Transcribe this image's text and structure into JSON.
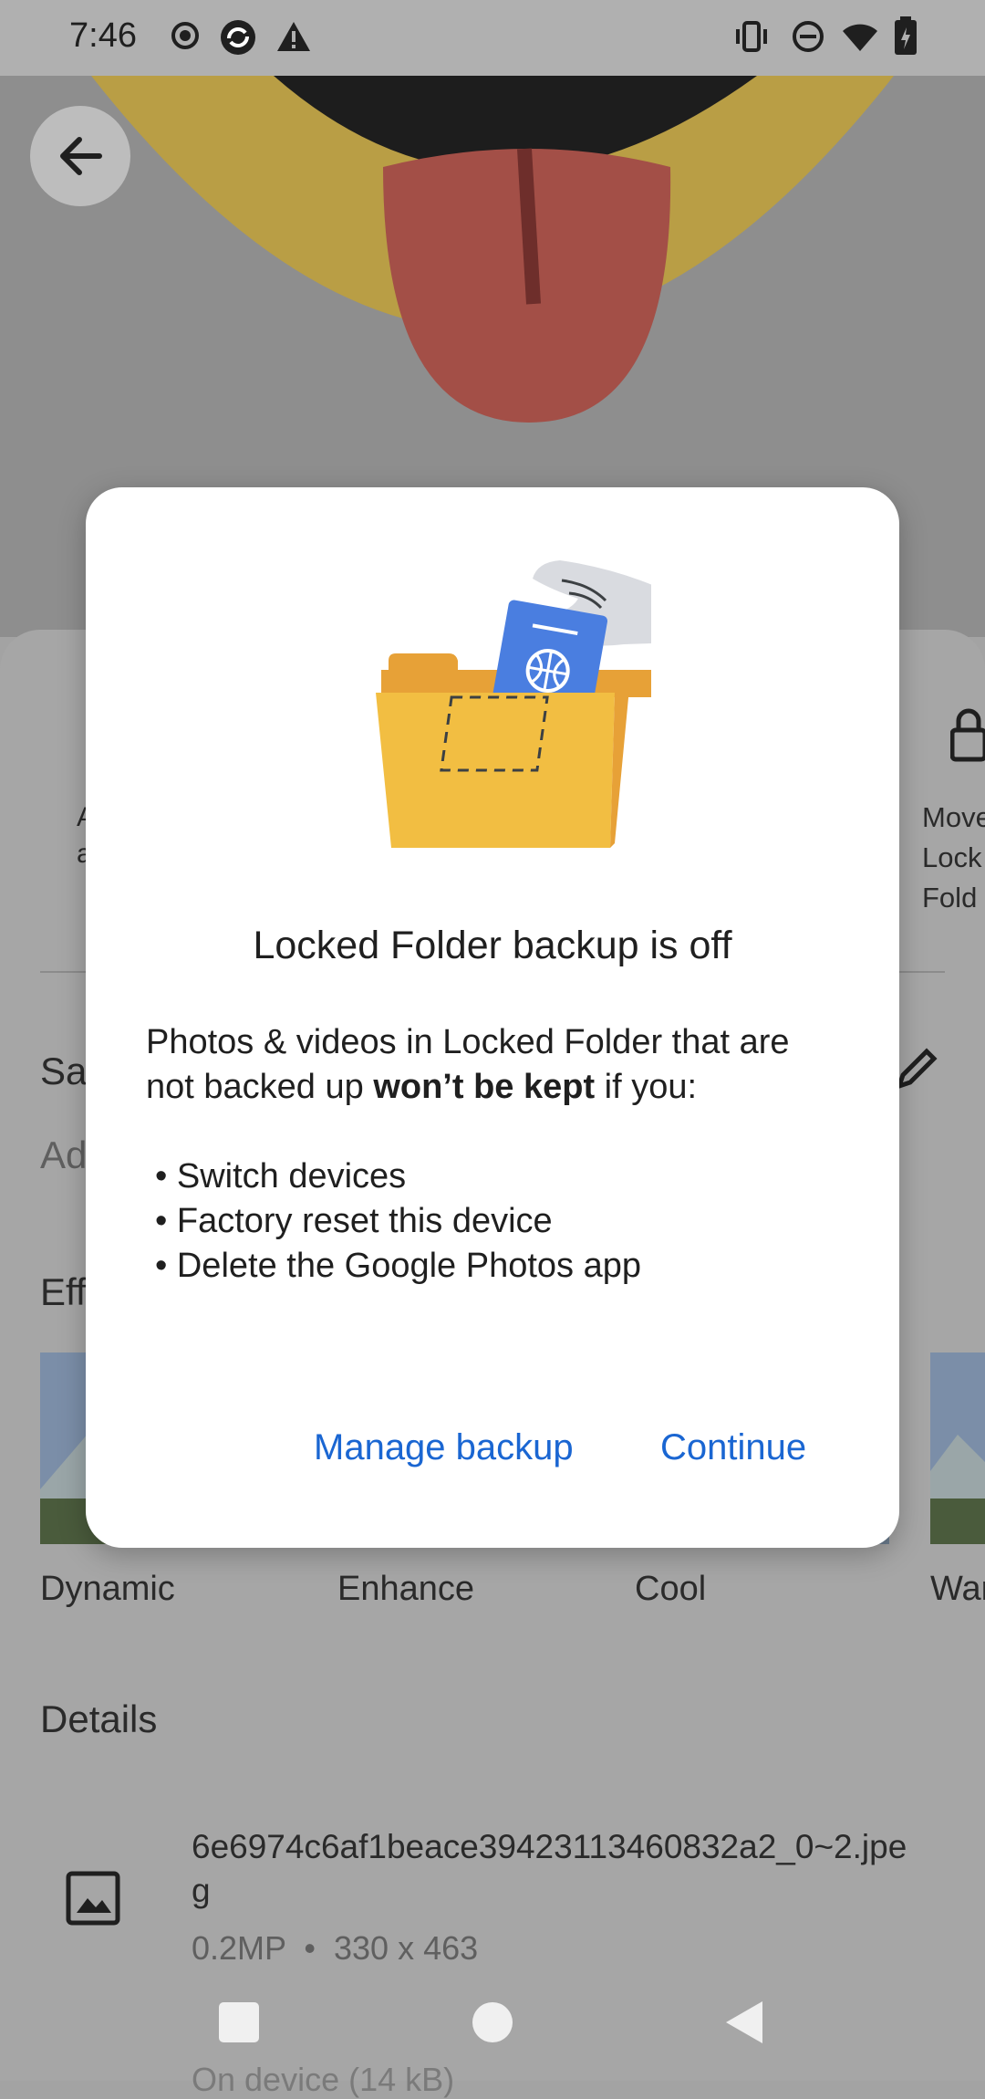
{
  "status_bar": {
    "time": "7:46"
  },
  "sheet": {
    "action_left_label": "A\na",
    "action_right_label": "Move\nLock\nFold",
    "section_save_label": "Sa",
    "add_placeholder": "Ad",
    "effects_label": "Eff",
    "effects": [
      {
        "label": "Dynamic"
      },
      {
        "label": "Enhance"
      },
      {
        "label": "Cool"
      },
      {
        "label": "War"
      }
    ],
    "details_label": "Details",
    "file_name": "6e6974c6af1beace39423113460832a2_0~2.jpe\ng",
    "file_meta": "0.2MP  •  330 x 463",
    "storage": "On device (14 kB)"
  },
  "dialog": {
    "title": "Locked Folder backup is off",
    "body_intro_1": "Photos & videos in Locked Folder that are",
    "body_intro_2_a": "not backed up ",
    "body_intro_2_bold": "won’t be kept",
    "body_intro_2_b": " if you:",
    "bullets": [
      "• Switch devices",
      "• Factory reset this device",
      "• Delete the Google Photos app"
    ],
    "manage_button": "Manage backup",
    "continue_button": "Continue"
  },
  "colors": {
    "accent": "#1a66d2",
    "folder": "#f2be42",
    "passport": "#4a7ee0"
  }
}
